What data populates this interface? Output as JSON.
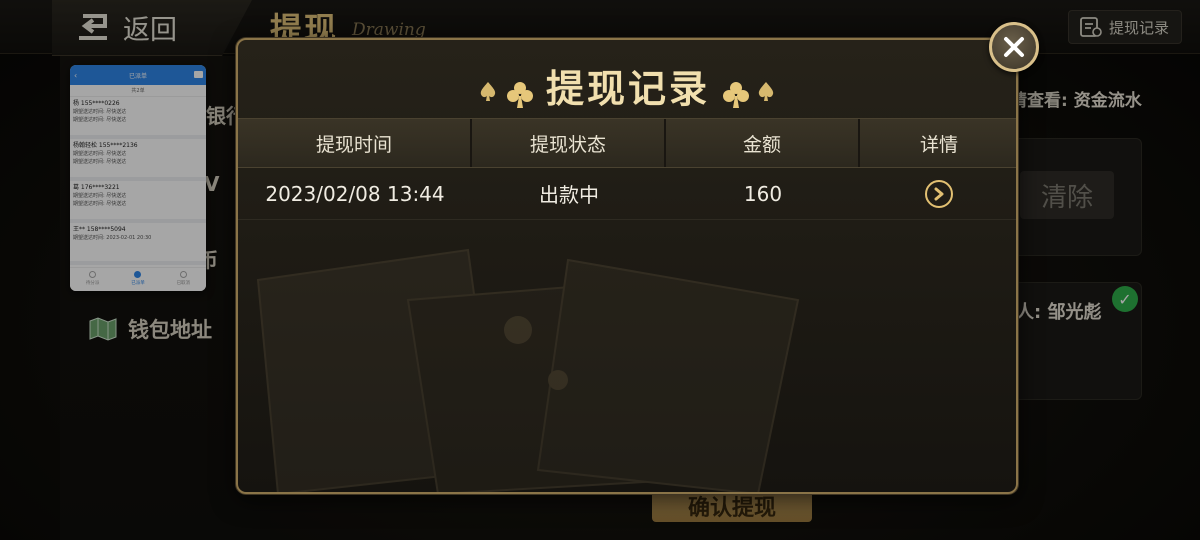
{
  "header": {
    "back_label": "返回",
    "title": "提现",
    "title_en": "Drawing",
    "record_button": "提现记录"
  },
  "background": {
    "left_item_1": "银行",
    "left_item_2": "V",
    "left_item_3": "币",
    "wallet_label": "钱包地址",
    "hint_prefix": "请查看:",
    "hint_link": "资金流水",
    "clear_button": "清除",
    "payee_label": "人: 邹光彪",
    "confirm_button": "确认提现"
  },
  "preview": {
    "header_title": "已派单",
    "subheader": "共2单",
    "items": [
      {
        "name": "杨 155****0226",
        "line1": "期望送达时间: 尽快送达",
        "line2": "期望送达时间: 尽快送达"
      },
      {
        "name": "杨翰轻松 155****2136",
        "line1": "期望送达时间: 尽快送达",
        "line2": "期望送达时间: 尽快送达"
      },
      {
        "name": "葛 176****3221",
        "line1": "期望送达时间: 尽快送达",
        "line2": "期望送达时间: 尽快送达"
      },
      {
        "name": "王** 158****5094",
        "line1": "期望送达时间: 2023-02-01 20:30",
        "line2": ""
      }
    ],
    "tabs": [
      "待分派",
      "已派单",
      "已取消"
    ]
  },
  "modal": {
    "title": "提现记录",
    "columns": [
      "提现时间",
      "提现状态",
      "金额",
      "详情"
    ],
    "rows": [
      {
        "time": "2023/02/08 13:44",
        "status": "出款中",
        "amount": "160"
      }
    ]
  },
  "colors": {
    "gold": "#e0c27a",
    "modal_border": "#8a7448",
    "check_green": "#2fae4a",
    "preview_blue": "#2f86e8"
  }
}
